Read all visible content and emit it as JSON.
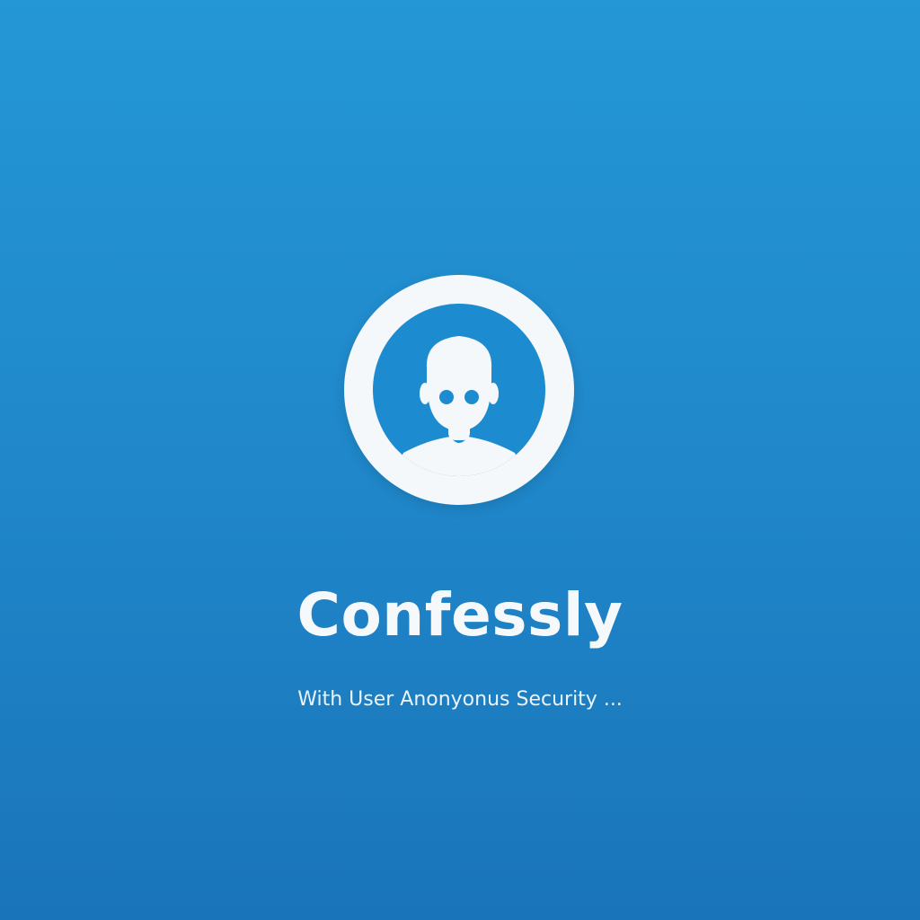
{
  "app": {
    "name": "Confessly",
    "tagline": "With User Anonyonus Security ..."
  },
  "logo": {
    "icon": "anonymous-user-icon"
  },
  "colors": {
    "background_top": "#2497d6",
    "background_bottom": "#1a74b9",
    "logo_ring": "#f4f8fb",
    "logo_fill": "#1c8bd0",
    "text": "#f6f9fc"
  }
}
